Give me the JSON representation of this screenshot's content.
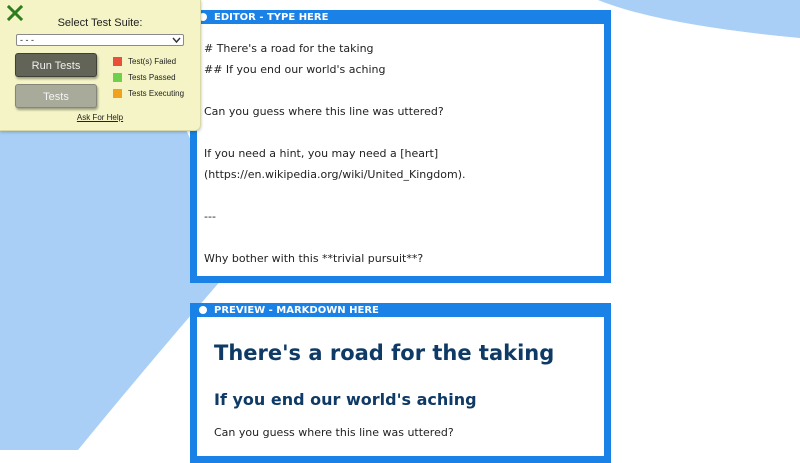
{
  "colors": {
    "panel_background": "#f4f4c6",
    "pane_border": "#1a82e6",
    "page_wave": "#a9cff6",
    "heading_text": "#0f3a66",
    "close_icon": "#2e7d1f",
    "status_failed": "#e8503a",
    "status_passed": "#6fd04c",
    "status_executing": "#f0a21c"
  },
  "test_panel": {
    "close_icon": "close-icon",
    "suite_label": "Select Test Suite:",
    "suite_select_value": "- - -",
    "run_tests_label": "Run Tests",
    "tests_label": "Tests",
    "legend": [
      {
        "label": "Test(s) Failed",
        "color": "#e8503a"
      },
      {
        "label": "Tests Passed",
        "color": "#6fd04c"
      },
      {
        "label": "Tests Executing",
        "color": "#f0a21c"
      }
    ],
    "help_link": "Ask For Help"
  },
  "editor": {
    "title": "EDITOR - TYPE HERE",
    "text": "# There's a road for the taking\n## If you end our world's aching\n\nCan you guess where this line was uttered?\n\nIf you need a hint, you may need a [heart]\n(https://en.wikipedia.org/wiki/United_Kingdom).\n\n---\n\nWhy bother with this **trivial pursuit**?"
  },
  "preview": {
    "title": "PREVIEW - MARKDOWN HERE",
    "h1": "There's a road for the taking",
    "h2": "If you end our world's aching",
    "paragraph": "Can you guess where this line was uttered?"
  }
}
